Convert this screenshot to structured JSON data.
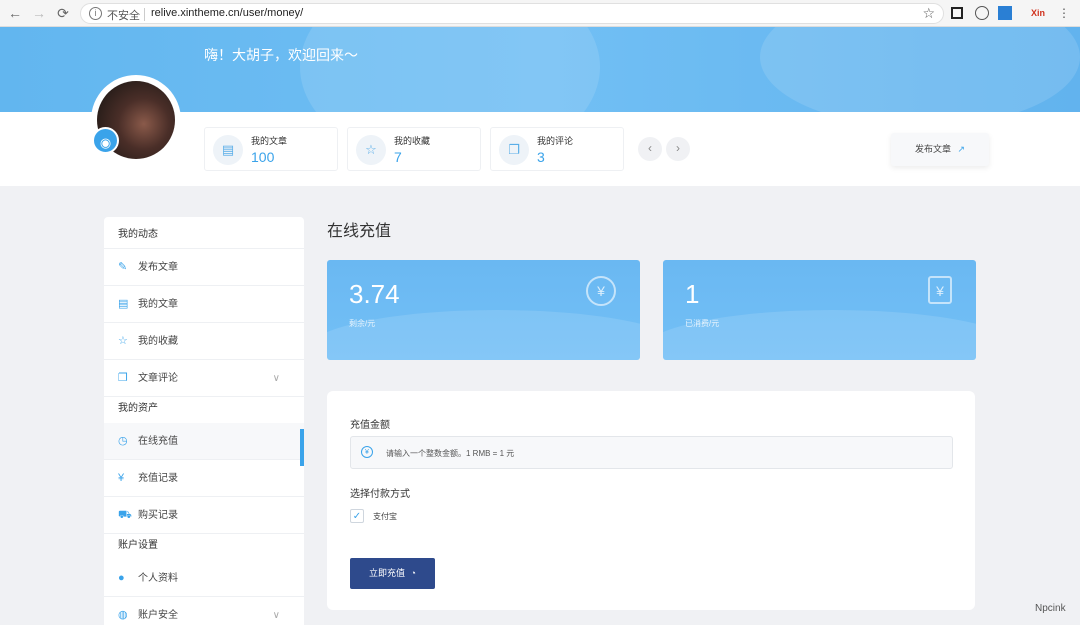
{
  "browser": {
    "back_icon": "←",
    "forward_icon": "→",
    "reload_icon": "C",
    "security_label": "不安全",
    "url": "relive.xintheme.cn/user/money/",
    "bookmark_icon": "☆",
    "ext_label": "Xin"
  },
  "header": {
    "welcome": "嗨！大胡子，欢迎回来～",
    "stats": [
      {
        "label": "我的文章",
        "value": "100",
        "icon": "document-icon"
      },
      {
        "label": "我的收藏",
        "value": "7",
        "icon": "star-icon"
      },
      {
        "label": "我的评论",
        "value": "3",
        "icon": "comment-icon"
      }
    ],
    "prev_icon": "‹",
    "next_icon": "›",
    "publish_label": "发布文章"
  },
  "sidebar": {
    "sections": [
      {
        "title": "我的动态"
      },
      {
        "title": "我的资产"
      },
      {
        "title": "账户设置"
      }
    ],
    "items": [
      {
        "label": "发布文章",
        "icon": "edit-icon"
      },
      {
        "label": "我的文章",
        "icon": "document-icon"
      },
      {
        "label": "我的收藏",
        "icon": "star-icon"
      },
      {
        "label": "文章评论",
        "icon": "comment-icon"
      },
      {
        "label": "在线充值",
        "icon": "recharge-icon"
      },
      {
        "label": "充值记录",
        "icon": "record-icon"
      },
      {
        "label": "购买记录",
        "icon": "cart-icon"
      },
      {
        "label": "个人资料",
        "icon": "user-icon"
      },
      {
        "label": "账户安全",
        "icon": "security-icon"
      }
    ]
  },
  "main": {
    "title": "在线充值",
    "balance": {
      "value": "3.74",
      "label": "剩余/元"
    },
    "spent": {
      "value": "1",
      "label": "已消费/元"
    },
    "form": {
      "amount_label": "充值金额",
      "amount_placeholder": "请输入一个整数金额。1 RMB = 1 元",
      "payment_label": "选择付款方式",
      "payment_option": "支付宝",
      "submit_label": "立即充值"
    }
  },
  "watermark": "Npcink",
  "colors": {
    "accent": "#3aa3ea",
    "banner": "#68b9f1",
    "button": "#2e4a8c"
  }
}
